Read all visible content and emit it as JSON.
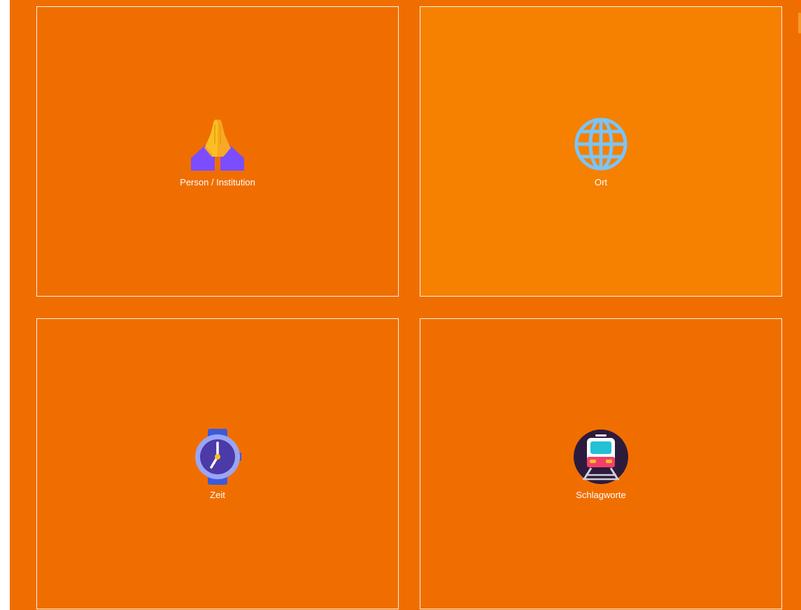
{
  "categories": [
    {
      "label": "Person / Institution",
      "icon": "folded-hands-icon"
    },
    {
      "label": "Ort",
      "icon": "globe-icon"
    },
    {
      "label": "Zeit",
      "icon": "wristwatch-icon"
    },
    {
      "label": "Schlagworte",
      "icon": "tram-icon"
    }
  ],
  "colors": {
    "background": "#f06e00",
    "tile_highlight": "#f68000",
    "tile_border": "#fff1dd",
    "label_text": "#ffffff"
  }
}
